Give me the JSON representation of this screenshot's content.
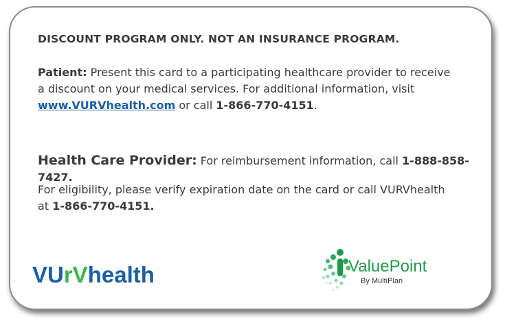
{
  "card": {
    "disclaimer": "DISCOUNT PROGRAM ONLY. NOT AN INSURANCE PROGRAM.",
    "patient": {
      "label": "Patient:",
      "text": " Present this card to a participating healthcare provider to receive a discount on your medical services. For additional information, visit ",
      "link": "www.VURVhealth.com",
      "text2": " or call ",
      "phone": "1-866-770-4151",
      "end": "."
    },
    "provider": {
      "label": "Health Care Provider:",
      "text": " For reimbursement information, call ",
      "phone": "1-888-858-7427."
    },
    "eligibility": {
      "text": "For eligibility, please verify expiration date on the card or call VURVhealth at ",
      "phone": "1-866-770-4151."
    },
    "logos": {
      "vurv": {
        "part1": "VU",
        "part2": "rV",
        "part3": "health",
        "blue": "#1a5fa8",
        "green": "#3db54a"
      },
      "valuepoint": {
        "name": "ValuePoint",
        "sub": "By MultiPlan",
        "green": "#1e9a47"
      }
    }
  }
}
